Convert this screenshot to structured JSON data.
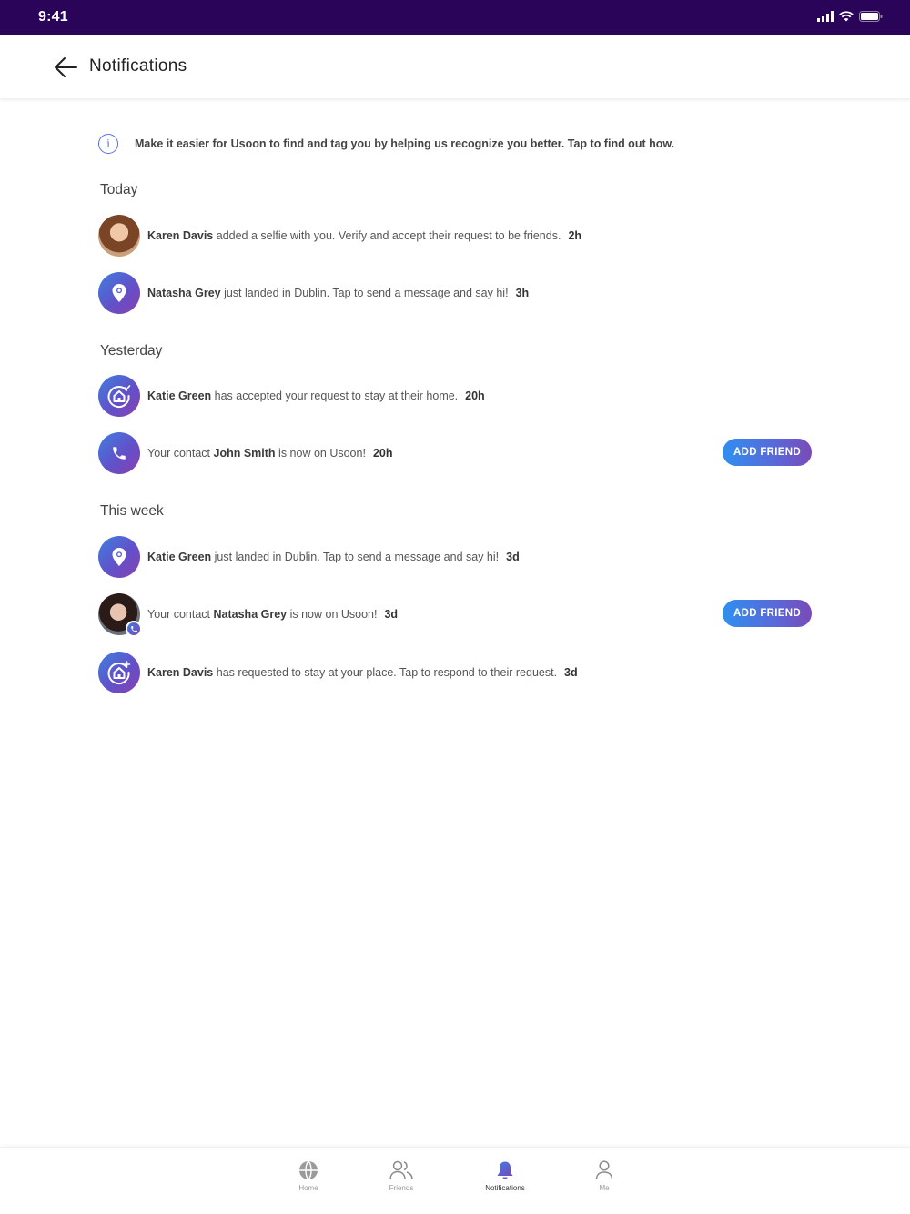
{
  "status_bar": {
    "time": "9:41"
  },
  "header": {
    "title": "Notifications"
  },
  "info_banner": {
    "text": "Make it easier for Usoon to find and tag you by helping us recognize you better. Tap to find out how.",
    "icon_text": "i"
  },
  "sections": {
    "today": "Today",
    "yesterday": "Yesterday",
    "this_week": "This week"
  },
  "notifications": [
    {
      "name": "Karen Davis",
      "text": " added a selfie with you. Verify and accept their request to be friends.",
      "time": "2h",
      "icon": "user-photo"
    },
    {
      "name": "Natasha Grey",
      "text": " just landed in Dublin. Tap to send a message and say hi!",
      "time": "3h",
      "icon": "location-pin-icon"
    },
    {
      "name": "Katie Green",
      "text": " has accepted your request to stay at their home.",
      "time": "20h",
      "icon": "home-accepted-icon"
    },
    {
      "prefix": "Your contact ",
      "name": "John Smith",
      "text": "  is now on Usoon!",
      "time": "20h",
      "icon": "phone-icon",
      "action": "ADD FRIEND"
    },
    {
      "name": "Katie Green",
      "text": " just landed in Dublin. Tap to send a message and say hi!",
      "time": "3d",
      "icon": "location-pin-icon"
    },
    {
      "prefix": "Your contact ",
      "name": "Natasha Grey",
      "text": " is now on Usoon!",
      "time": "3d",
      "icon": "user-photo",
      "action": "ADD FRIEND"
    },
    {
      "name": "Karen Davis",
      "text": " has requested to stay at your place. Tap to respond to their request.",
      "time": "3d",
      "icon": "home-request-icon"
    }
  ],
  "tab_bar": {
    "items": [
      {
        "label": "Home",
        "icon": "globe-icon"
      },
      {
        "label": "Friends",
        "icon": "friends-icon"
      },
      {
        "label": "Notifications",
        "icon": "bell-icon",
        "active": true
      },
      {
        "label": "Me",
        "icon": "person-icon"
      }
    ]
  },
  "colors": {
    "status_bar": "#2a0458",
    "accent_start": "#2f8ff0",
    "accent_end": "#7a4ab8"
  }
}
